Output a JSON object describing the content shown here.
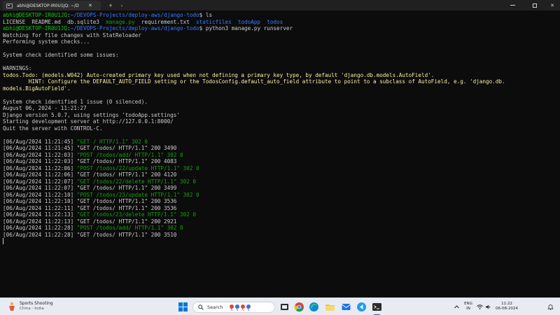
{
  "window": {
    "tab_title": "abhi@DESKTOP-IR0U1JQ: ~/D",
    "tab_close": "✕",
    "new_tab": "+",
    "tab_dropdown": "⌄",
    "close_glyph": "✕"
  },
  "terminal": {
    "lines": [
      [
        [
          "g",
          "abhi@DESKTOP-IR0U1JQ"
        ],
        [
          "w",
          ":"
        ],
        [
          "b",
          "~/DEVOPS-Projects/deploy-aws/django-todo"
        ],
        [
          "w",
          "$ ls"
        ]
      ],
      [
        [
          "w",
          "LICENSE  README.md  db.sqlite3  "
        ],
        [
          "gb",
          "manage.py"
        ],
        [
          "w",
          "  requirement.txt  "
        ],
        [
          "b",
          "staticfiles"
        ],
        [
          "w",
          "  "
        ],
        [
          "b",
          "todoApp"
        ],
        [
          "w",
          "  "
        ],
        [
          "b",
          "todos"
        ]
      ],
      [
        [
          "g",
          "abhi@DESKTOP-IR0U1JQ"
        ],
        [
          "w",
          ":"
        ],
        [
          "b",
          "~/DEVOPS-Projects/deploy-aws/django-todo"
        ],
        [
          "w",
          "$ python3 manage.py runserver"
        ]
      ],
      [
        [
          "w",
          "Watching for file changes with StatReloader"
        ]
      ],
      [
        [
          "w",
          "Performing system checks..."
        ]
      ],
      [
        [
          "w",
          ""
        ]
      ],
      [
        [
          "w",
          "System check identified some issues:"
        ]
      ],
      [
        [
          "w",
          ""
        ]
      ],
      [
        [
          "w",
          "WARNINGS:"
        ]
      ],
      [
        [
          "y",
          "todos.Todo: (models.W042) Auto-created primary key used when not defining a primary key type, by default 'django.db.models.AutoField'."
        ]
      ],
      [
        [
          "y",
          "        HINT: Configure the DEFAULT_AUTO_FIELD setting or the TodosConfig.default_auto_field attribute to point to a subclass of AutoField, e.g. 'django.db."
        ]
      ],
      [
        [
          "y",
          "models.BigAutoField'."
        ]
      ],
      [
        [
          "w",
          ""
        ]
      ],
      [
        [
          "w",
          "System check identified 1 issue (0 silenced)."
        ]
      ],
      [
        [
          "w",
          "August 06, 2024 - 11:21:27"
        ]
      ],
      [
        [
          "w",
          "Django version 5.0.7, using settings 'todoApp.settings'"
        ]
      ],
      [
        [
          "w",
          "Starting development server at http://127.0.0.1:8000/"
        ]
      ],
      [
        [
          "w",
          "Quit the server with CONTROL-C."
        ]
      ],
      [
        [
          "w",
          ""
        ]
      ],
      [
        [
          "w",
          "[06/Aug/2024 11:21:45] "
        ],
        [
          "gb",
          "\"GET / HTTP/1.1\" 302 0"
        ]
      ],
      [
        [
          "w",
          "[06/Aug/2024 11:21:45] \"GET /todos/ HTTP/1.1\" 200 3490"
        ]
      ],
      [
        [
          "w",
          "[06/Aug/2024 11:22:03] "
        ],
        [
          "gb",
          "\"POST /todos/add/ HTTP/1.1\" 302 0"
        ]
      ],
      [
        [
          "w",
          "[06/Aug/2024 11:22:03] \"GET /todos/ HTTP/1.1\" 200 4083"
        ]
      ],
      [
        [
          "w",
          "[06/Aug/2024 11:22:06] "
        ],
        [
          "gb",
          "\"POST /todos/22/update HTTP/1.1\" 302 0"
        ]
      ],
      [
        [
          "w",
          "[06/Aug/2024 11:22:06] \"GET /todos/ HTTP/1.1\" 200 4120"
        ]
      ],
      [
        [
          "w",
          "[06/Aug/2024 11:22:07] "
        ],
        [
          "gb",
          "\"GET /todos/22/delete HTTP/1.1\" 302 0"
        ]
      ],
      [
        [
          "w",
          "[06/Aug/2024 11:22:07] \"GET /todos/ HTTP/1.1\" 200 3499"
        ]
      ],
      [
        [
          "w",
          "[06/Aug/2024 11:22:10] "
        ],
        [
          "gb",
          "\"POST /todos/23/update HTTP/1.1\" 302 0"
        ]
      ],
      [
        [
          "w",
          "[06/Aug/2024 11:22:10] \"GET /todos/ HTTP/1.1\" 200 3536"
        ]
      ],
      [
        [
          "w",
          "[06/Aug/2024 11:22:11] \"GET /todos/ HTTP/1.1\" 200 3536"
        ]
      ],
      [
        [
          "w",
          "[06/Aug/2024 11:22:13] "
        ],
        [
          "gb",
          "\"GET /todos/23/delete HTTP/1.1\" 302 0"
        ]
      ],
      [
        [
          "w",
          "[06/Aug/2024 11:22:13] \"GET /todos/ HTTP/1.1\" 200 2921"
        ]
      ],
      [
        [
          "w",
          "[06/Aug/2024 11:22:28] "
        ],
        [
          "gb",
          "\"POST /todos/add/ HTTP/1.1\" 302 0"
        ]
      ],
      [
        [
          "w",
          "[06/Aug/2024 11:22:28] \"GET /todos/ HTTP/1.1\" 200 3510"
        ]
      ]
    ]
  },
  "taskbar": {
    "weather_title": "Sports Shooting",
    "weather_sub": "China - India",
    "search_placeholder": "Search",
    "lang_line1": "ENG",
    "lang_line2": "IN",
    "time": "11:22",
    "date": "06-08-2024",
    "icons": [
      "windows-start-icon",
      "search-icon",
      "task-view-icon",
      "file-explorer-icon",
      "chrome-icon",
      "edge-icon",
      "mail-icon",
      "vscode-icon",
      "terminal-icon"
    ]
  },
  "colors": {
    "prompt_user": "#16c60c",
    "prompt_path": "#3b78ff",
    "warning": "#f9f1a5",
    "http_green": "#13a10e",
    "terminal_bg": "#0c0c0c",
    "taskbar_bg": "#e8ecf2"
  }
}
